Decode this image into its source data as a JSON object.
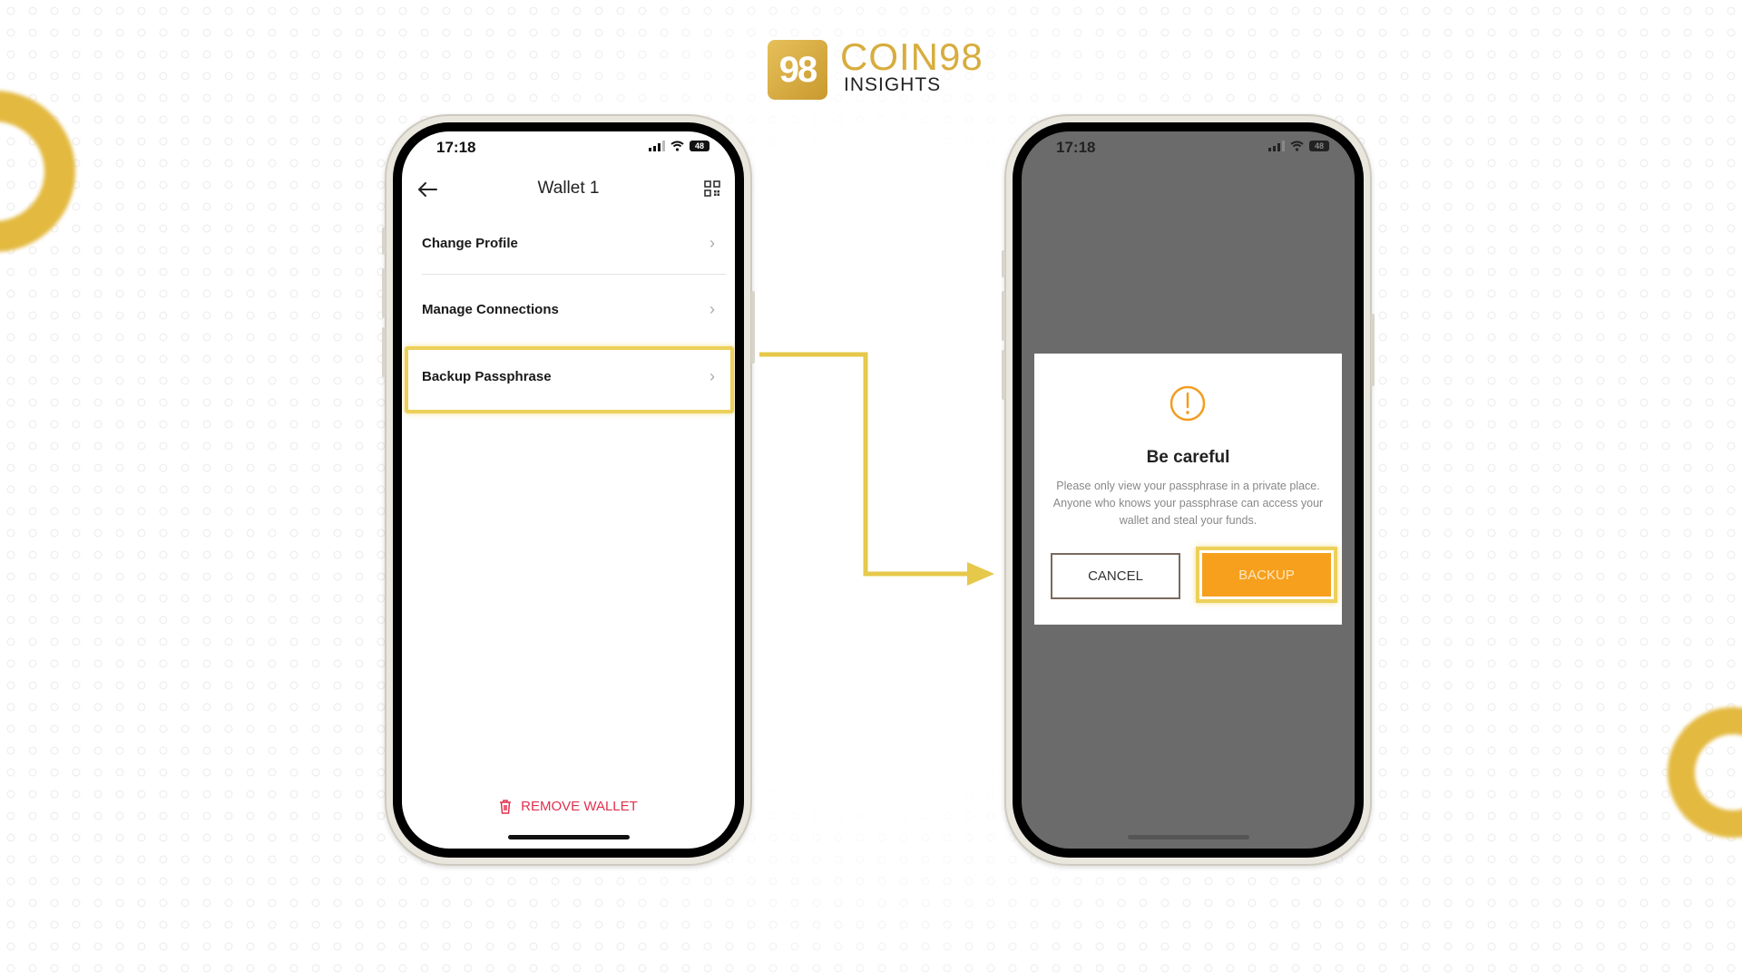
{
  "branding": {
    "logo_mark": "98",
    "title": "COIN98",
    "subtitle": "INSIGHTS",
    "accent_color": "#d7ad3e"
  },
  "phone_left": {
    "status": {
      "time": "17:18",
      "battery": "48"
    },
    "nav": {
      "title": "Wallet 1",
      "back_icon": "arrow-left-icon",
      "right_icon": "qr-code-icon"
    },
    "menu": [
      {
        "label": "Change Profile",
        "highlighted": false
      },
      {
        "label": "Manage Connections",
        "highlighted": false
      },
      {
        "label": "Backup Passphrase",
        "highlighted": true
      }
    ],
    "remove_wallet_label": "REMOVE WALLET",
    "remove_color": "#e0304e"
  },
  "phone_right": {
    "status": {
      "time": "17:18",
      "battery": "48"
    },
    "dialog": {
      "icon": "warning-circle-icon",
      "title": "Be careful",
      "message": "Please only view your passphrase in a private place. Anyone who knows your passphrase can access your wallet and steal your funds.",
      "cancel_label": "CANCEL",
      "confirm_label": "BACKUP",
      "confirm_color": "#f7a01d",
      "highlight_color": "#ecd05a"
    }
  }
}
